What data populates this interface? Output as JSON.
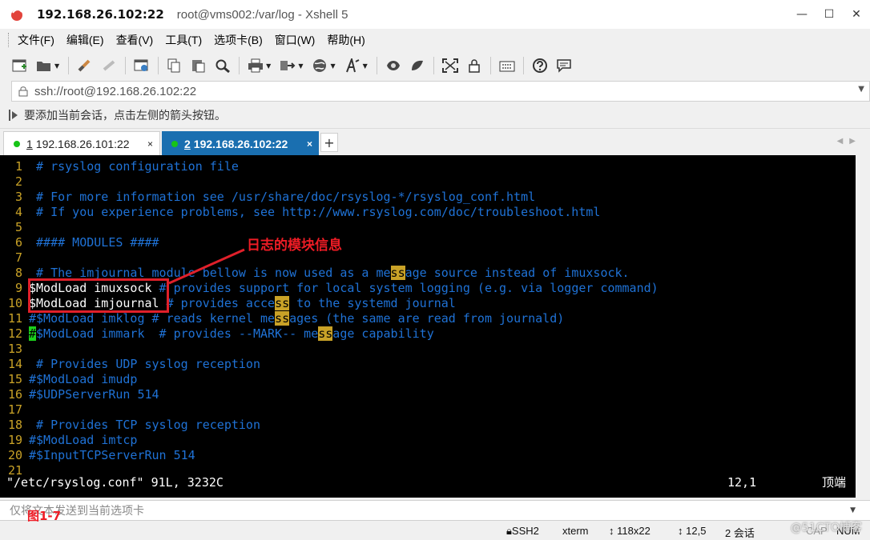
{
  "titlebar": {
    "host": "192.168.26.102:22",
    "rest": "root@vms002:/var/log - Xshell 5",
    "min": "—",
    "max": "☐",
    "close": "✕"
  },
  "menu": [
    "文件(F)",
    "编辑(E)",
    "查看(V)",
    "工具(T)",
    "选项卡(B)",
    "窗口(W)",
    "帮助(H)"
  ],
  "address": {
    "value": "ssh://root@192.168.26.102:22"
  },
  "hint": {
    "text": "要添加当前会话，点击左侧的箭头按钮。"
  },
  "tabs": [
    {
      "num": "1",
      "label": " 192.168.26.101:22",
      "close": "×"
    },
    {
      "num": "2",
      "label": " 192.168.26.102:22",
      "close": "×"
    }
  ],
  "tab_add": "+",
  "terminal": {
    "line_numbers": [
      "1",
      "2",
      "3",
      "4",
      "5",
      "6",
      "7",
      "8",
      "9",
      "10",
      "11",
      "12",
      "13",
      "14",
      "15",
      "16",
      "17",
      "18",
      "19",
      "20",
      "21"
    ],
    "l1": " # rsyslog configuration file",
    "l3": " # For more information see /usr/share/doc/rsyslog-*/rsyslog_conf.html",
    "l4": " # If you experience problems, see http://www.rsyslog.com/doc/troubleshoot.html",
    "l6": " #### MODULES ####",
    "l8a": " # The imjournal module bellow is now used as a me",
    "l8b": "ss",
    "l8c": "age source instead of imuxsock.",
    "l9a": "$ModLoad imuxsock",
    "l9b": " # provides support for local system logging (e.g. via logger command)",
    "l10a": "$ModLoad imjournal",
    "l10b": " # provides acce",
    "l10c": "ss",
    "l10d": " to the systemd journal",
    "l11a": "#$ModLoad imklog # reads kernel me",
    "l11b": "ss",
    "l11c": "ages (the same are read from journald)",
    "l12a": "#",
    "l12b": "$ModLoad immark  # provides --MARK-- me",
    "l12c": "ss",
    "l12d": "age capability",
    "l14": " # Provides UDP syslog reception",
    "l15": "#$ModLoad imudp",
    "l16": "#$UDPServerRun 514",
    "l18": " # Provides TCP syslog reception",
    "l19": "#$ModLoad imtcp",
    "l20": "#$InputTCPServerRun 514",
    "status_file": "\"/etc/rsyslog.conf\" 91L, 3232C",
    "status_pos": "12,1",
    "status_top": "顶端"
  },
  "annotation": "日志的模块信息",
  "figure_label": "图1-7",
  "sendbar": {
    "text": "仅将文本发送到当前选项卡"
  },
  "statusbar": {
    "ssh": "SSH2",
    "term": "xterm",
    "size": "118x22",
    "pos": "12,5",
    "sessions": "2 会话",
    "cap": "CAP",
    "num": "NUM"
  },
  "watermark": "@51CTO博客",
  "colors": {
    "comment": "#1f72d6",
    "linenum": "#c9a227",
    "highlight": "#c9a227",
    "cursor": "#1cd11c",
    "annot_red": "#ee1c25",
    "tab_active": "#1a6fb0"
  }
}
